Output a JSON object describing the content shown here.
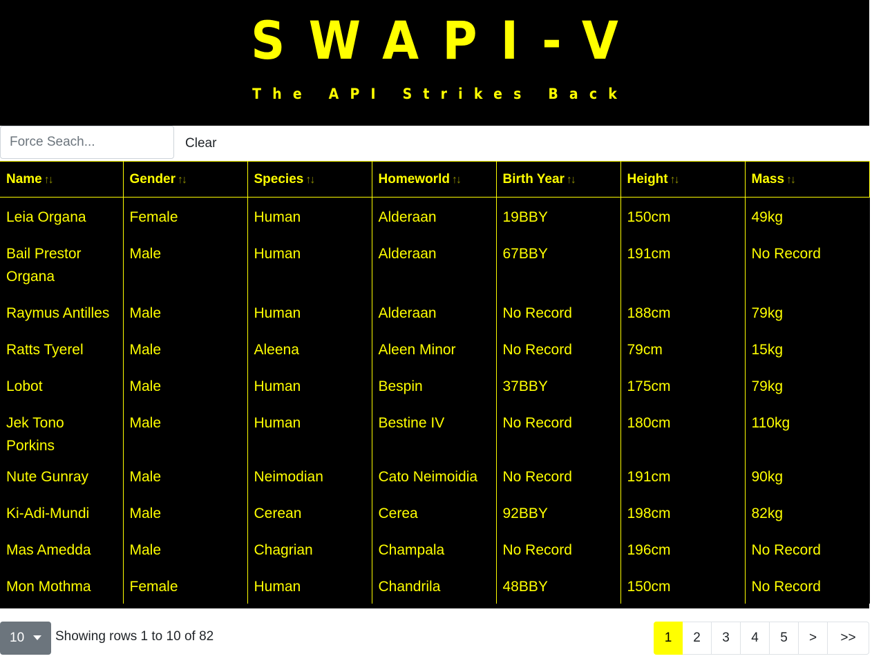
{
  "header": {
    "title": "SWAPI-V",
    "subtitle": "The API Strikes Back"
  },
  "search": {
    "placeholder": "Force Seach...",
    "value": "",
    "clear_label": "Clear"
  },
  "table": {
    "sort_glyph": "↑↓",
    "columns": [
      "Name",
      "Gender",
      "Species",
      "Homeworld",
      "Birth Year",
      "Height",
      "Mass"
    ],
    "rows": [
      [
        "Leia Organa",
        "Female",
        "Human",
        "Alderaan",
        "19BBY",
        "150cm",
        "49kg"
      ],
      [
        "Bail Prestor Organa",
        "Male",
        "Human",
        "Alderaan",
        "67BBY",
        "191cm",
        "No Record"
      ],
      [
        "Raymus Antilles",
        "Male",
        "Human",
        "Alderaan",
        "No Record",
        "188cm",
        "79kg"
      ],
      [
        "Ratts Tyerel",
        "Male",
        "Aleena",
        "Aleen Minor",
        "No Record",
        "79cm",
        "15kg"
      ],
      [
        "Lobot",
        "Male",
        "Human",
        "Bespin",
        "37BBY",
        "175cm",
        "79kg"
      ],
      [
        "Jek Tono Porkins",
        "Male",
        "Human",
        "Bestine IV",
        "No Record",
        "180cm",
        "110kg"
      ],
      [
        "Nute Gunray",
        "Male",
        "Neimodian",
        "Cato Neimoidia",
        "No Record",
        "191cm",
        "90kg"
      ],
      [
        "Ki-Adi-Mundi",
        "Male",
        "Cerean",
        "Cerea",
        "92BBY",
        "198cm",
        "82kg"
      ],
      [
        "Mas Amedda",
        "Male",
        "Chagrian",
        "Champala",
        "No Record",
        "196cm",
        "No Record"
      ],
      [
        "Mon Mothma",
        "Female",
        "Human",
        "Chandrila",
        "48BBY",
        "150cm",
        "No Record"
      ]
    ]
  },
  "footer": {
    "page_size": "10",
    "rows_info": "Showing rows 1 to 10 of 82",
    "pages": [
      "1",
      "2",
      "3",
      "4",
      "5",
      ">",
      ">>"
    ],
    "active_page": "1"
  },
  "colors": {
    "accent": "#ffff00",
    "background": "#000000",
    "page_size_button": "#6c757d"
  }
}
